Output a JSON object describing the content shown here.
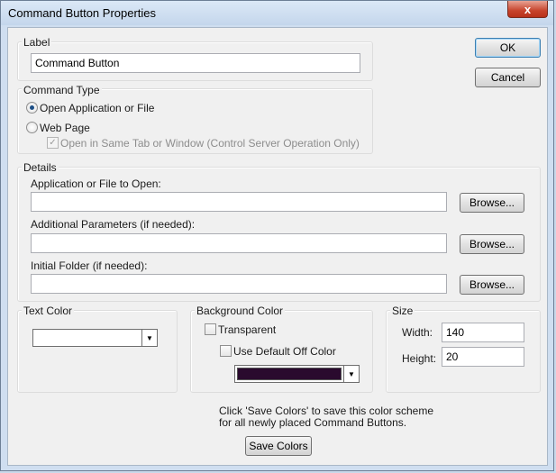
{
  "window": {
    "title": "Command Button Properties",
    "close_glyph": "x"
  },
  "label_group": {
    "title": "Label",
    "value": "Command Button"
  },
  "actions": {
    "ok_label": "OK",
    "cancel_label": "Cancel"
  },
  "command_type": {
    "title": "Command Type",
    "option_open": "Open Application or File",
    "option_web": "Web Page",
    "selected": "open",
    "same_tab_label": "Open in Same Tab or Window (Control Server Operation Only)",
    "same_tab_checked": true,
    "same_tab_enabled": false
  },
  "details": {
    "title": "Details",
    "app_label": "Application or File to Open:",
    "app_value": "",
    "params_label": "Additional Parameters (if needed):",
    "params_value": "",
    "folder_label": "Initial Folder (if needed):",
    "folder_value": "",
    "browse_label": "Browse..."
  },
  "text_color": {
    "title": "Text Color",
    "color": "#ffffff"
  },
  "background_color": {
    "title": "Background Color",
    "transparent_label": "Transparent",
    "transparent_checked": false,
    "use_default_label": "Use Default Off Color",
    "use_default_checked": false,
    "color": "#2a0a2e"
  },
  "size": {
    "title": "Size",
    "width_label": "Width:",
    "width_value": "140",
    "height_label": "Height:",
    "height_value": "20"
  },
  "footer": {
    "note_line1": "Click 'Save Colors' to save this color scheme",
    "note_line2": "for all newly placed Command Buttons.",
    "save_colors_label": "Save Colors"
  },
  "icons": {
    "dropdown": "chevron-down-icon",
    "close": "close-icon",
    "check": "checkmark-icon"
  },
  "colors": {
    "title_bar": "#c4d6ec",
    "close_button": "#c7442c",
    "dialog_bg": "#f0f0f0"
  }
}
